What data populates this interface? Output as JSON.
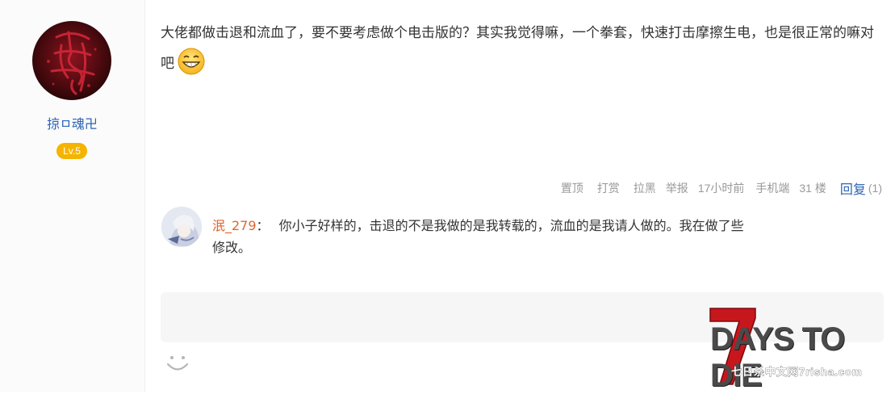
{
  "author": {
    "username": "掠ㅁ魂卍",
    "level": "Lv.5"
  },
  "post": {
    "text": "大佬都做击退和流血了，要不要考虑做个电击版的？其实我觉得嘛，一个拳套，快速打击摩擦生电，也是很正常的嘛对吧"
  },
  "meta": {
    "pin": "置顶",
    "tip": "打赏",
    "block": "拉黑",
    "report": "举报",
    "time": "17小时前",
    "device": "手机端",
    "floor": "31 楼",
    "reply_label": "回复",
    "reply_count": "(1)"
  },
  "comment": {
    "name": "泯_279",
    "separator": "：",
    "text": "你小子好样的，击退的不是我做的是我转载的，流血的是我请人做的。我在做了些修改。"
  },
  "watermark": {
    "title": "DAYS TO DIE",
    "number": "7",
    "subtitle": "七日杀中文网7risha.com"
  },
  "icons": {
    "grin": "grin-emoji-icon",
    "smiley": "smiley-icon"
  },
  "colors": {
    "link": "#2d64b3",
    "commenter": "#e0652d",
    "level_badge": "#f5b400",
    "watermark_red": "#c8161d"
  }
}
